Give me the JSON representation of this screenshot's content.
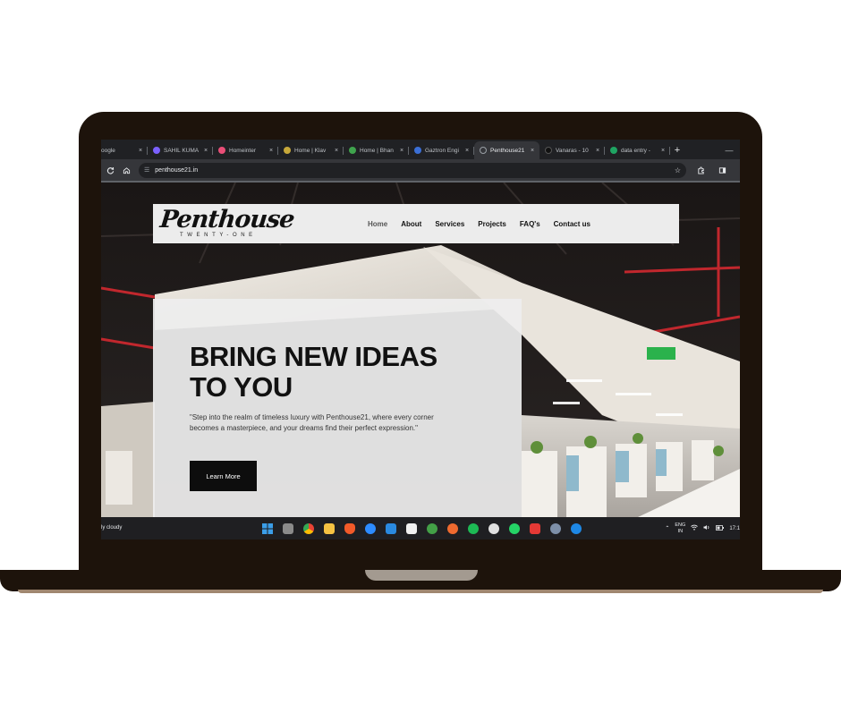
{
  "browser": {
    "tabs": [
      {
        "title": "oogle",
        "color": "#4285f4"
      },
      {
        "title": "SAHIL KUMA",
        "color": "#7b61ff"
      },
      {
        "title": "Homeinter",
        "color": "#e94e77"
      },
      {
        "title": "Home | Klav",
        "color": "#c7a83a"
      },
      {
        "title": "Home | Bhan",
        "color": "#3fa34d"
      },
      {
        "title": "Gaztron Engi",
        "color": "#3b6fd6"
      },
      {
        "title": "Penthouse21",
        "color": "#9aa0a6"
      },
      {
        "title": "Vanaras - 10",
        "color": "#222222"
      },
      {
        "title": "data entry -",
        "color": "#1fa463"
      }
    ],
    "close_glyph": "×",
    "new_tab_glyph": "+",
    "minimize_glyph": "—",
    "url": "penthouse21.in"
  },
  "site": {
    "logo": "Penthouse",
    "logo_sub": "TWENTY-ONE",
    "nav": [
      "Home",
      "About",
      "Services",
      "Projects",
      "FAQ's",
      "Contact us"
    ],
    "hero_title": "BRING NEW IDEAS TO YOU",
    "hero_text": "\"Step into the realm of timeless luxury with Penthouse21, where every corner becomes a masterpiece, and your dreams find their perfect expression.\"",
    "cta": "Learn More"
  },
  "taskbar": {
    "weather": "ly cloudy",
    "apps": [
      {
        "name": "windows-start",
        "color": "#3b9ee8"
      },
      {
        "name": "file-viewer",
        "color": "#8a8a8a"
      },
      {
        "name": "chrome",
        "color": "#f2b01e"
      },
      {
        "name": "file-explorer",
        "color": "#f5c242"
      },
      {
        "name": "brave",
        "color": "#f25a29"
      },
      {
        "name": "zoom",
        "color": "#2d8cff"
      },
      {
        "name": "vscode",
        "color": "#2a8ae0"
      },
      {
        "name": "notepad",
        "color": "#f0f0f0"
      },
      {
        "name": "mongodb",
        "color": "#43a047"
      },
      {
        "name": "postman",
        "color": "#ef6a2f"
      },
      {
        "name": "spotify",
        "color": "#1db954"
      },
      {
        "name": "slack",
        "color": "#e0e0e0"
      },
      {
        "name": "whatsapp",
        "color": "#25d366"
      },
      {
        "name": "anydesk",
        "color": "#e53935"
      },
      {
        "name": "settings",
        "color": "#7d8fa8"
      },
      {
        "name": "app-blue",
        "color": "#1e88e5"
      }
    ],
    "lang_top": "ENG",
    "lang_bottom": "IN",
    "time": "17:1"
  }
}
